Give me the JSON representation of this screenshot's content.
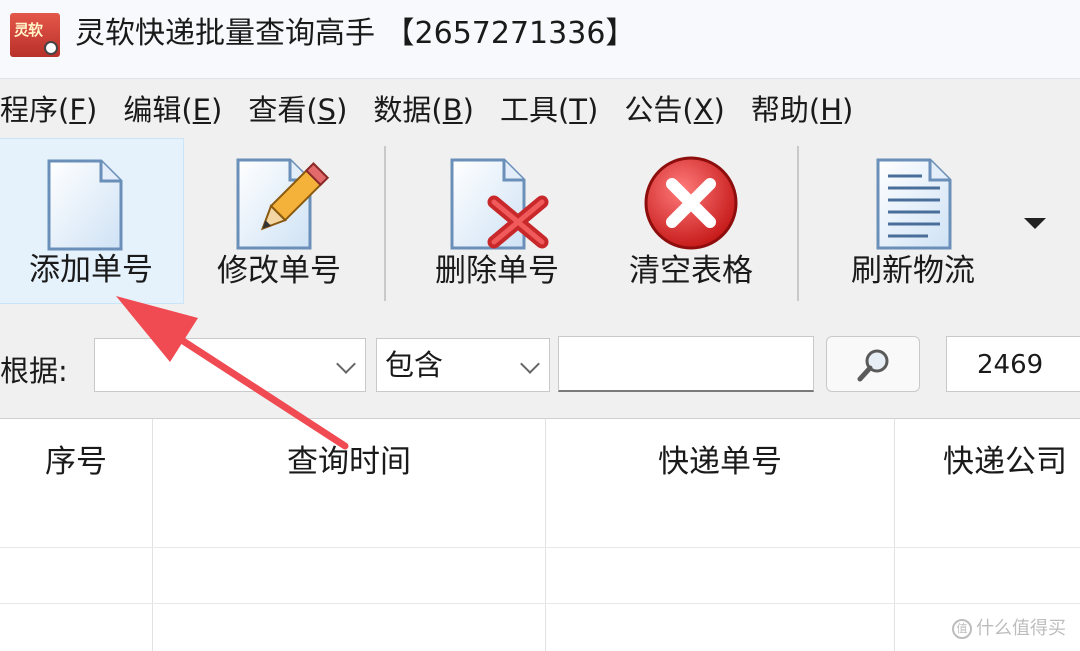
{
  "window": {
    "title": "灵软快递批量查询高手 【2657271336】",
    "logo_text": "灵软"
  },
  "menu": [
    {
      "label": "程序(",
      "key": "F",
      "end": ")"
    },
    {
      "label": "编辑(",
      "key": "E",
      "end": ")"
    },
    {
      "label": "查看(",
      "key": "S",
      "end": ")"
    },
    {
      "label": "数据(",
      "key": "B",
      "end": ")"
    },
    {
      "label": "工具(",
      "key": "T",
      "end": ")"
    },
    {
      "label": "公告(",
      "key": "X",
      "end": ")"
    },
    {
      "label": "帮助(",
      "key": "H",
      "end": ")"
    }
  ],
  "toolbar": {
    "add": "添加单号",
    "edit": "修改单号",
    "delete": "删除单号",
    "clear": "清空表格",
    "refresh": "刷新物流"
  },
  "filter": {
    "label": "根据:",
    "field_value": "",
    "match_value": "包含",
    "keyword_value": "",
    "count_value": "2469"
  },
  "table": {
    "columns": [
      "序号",
      "查询时间",
      "快递单号",
      "快递公司"
    ],
    "rows": []
  },
  "watermark": {
    "text": "什么值得买",
    "logo": "值"
  }
}
